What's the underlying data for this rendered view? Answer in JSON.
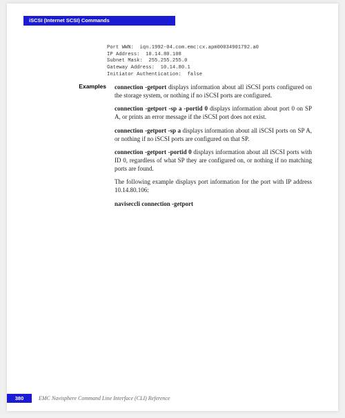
{
  "header": {
    "title": "iSCSI (Internet SCSI) Commands"
  },
  "code": {
    "lines": "Port WWN:  iqn.1992-04.com.emc:cx.apm00034901792.a0\nIP Address:  10.14.80.108\nSubnet Mask:  255.255.255.0\nGateway Address:  10.14.80.1\nInitiator Authentication:  false"
  },
  "side": {
    "examples_label": "Examples"
  },
  "examples": {
    "p1_cmd": "connection -getport",
    "p1_rest": " displays information about all iSCSI ports configured on the storage system, or nothing if no iSCSI ports are configured.",
    "p2_cmd": "connection -getport -sp a -portid 0",
    "p2_rest": " displays information about port 0 on SP A, or prints an error message if the iSCSI port does not exist.",
    "p3_cmd": "connection -getport -sp a",
    "p3_rest": " displays information about all iSCSI ports on SP A, or nothing if no iSCSI ports are configured on that SP.",
    "p4_cmd": "connection -getport -portid 0",
    "p4_rest": " displays information about all iSCSI ports with ID 0, regardless of what SP they are configured on, or nothing if no matching ports are found.",
    "p5": "The following example displays port information for the port with IP address 10.14.80.106:",
    "p6_cmd": "naviseccli connection -getport"
  },
  "footer": {
    "page": "380",
    "title": "EMC Navisphere Command Line Interface (CLI) Reference"
  }
}
